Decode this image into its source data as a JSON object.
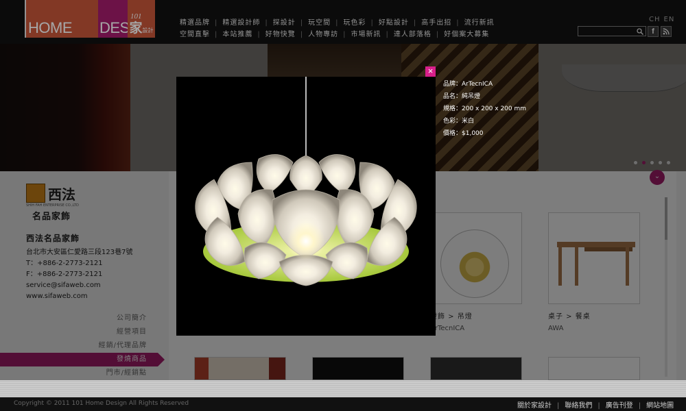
{
  "header": {
    "logo": {
      "home": "HOME",
      "design": "DESIGN",
      "jia": "家",
      "jia_small": "設計",
      "num": "101"
    },
    "nav_row1": [
      "精選品牌",
      "精選設計師",
      "探設計",
      "玩空間",
      "玩色彩",
      "好點設計",
      "高手出招",
      "流行新訊"
    ],
    "nav_row2": [
      "空間直擊",
      "本站推薦",
      "好物快覽",
      "人物專訪",
      "市場新訊",
      "達人部落格",
      "好個案大募集"
    ],
    "lang": [
      "CH",
      "EN"
    ],
    "search_placeholder": "",
    "facebook_label": "f"
  },
  "colors": {
    "brand_magenta": "#a61c6d",
    "brand_orange": "#c8563a",
    "close_pink": "#d81f8a"
  },
  "brand": {
    "logo_text": "西法",
    "logo_en": "SHIH FAH ENTERPRISE CO.,LTD",
    "subtitle": "名品家飾",
    "shop_name": "西法名品家飾",
    "address": "台北市大安區仁愛路三段123巷7號",
    "tel": "T：+886-2-2773-2121",
    "fax": "F：+886-2-2773-2121",
    "email": "service@sifaweb.com",
    "website": "www.sifaweb.com"
  },
  "side_menu": [
    {
      "label": "公司簡介",
      "active": false
    },
    {
      "label": "經營項目",
      "active": false
    },
    {
      "label": "經銷/代理品牌",
      "active": false
    },
    {
      "label": "發燒商品",
      "active": true
    },
    {
      "label": "門市/經銷點",
      "active": false
    }
  ],
  "products": {
    "item1_caption": "燈飾 > 吊燈",
    "item1_brand": "ArTecnICA",
    "item2_caption": "桌子 > 餐桌",
    "item2_brand": "AWA"
  },
  "banner": {
    "active_dot": 1,
    "dot_count": 5
  },
  "modal": {
    "close_label": "×",
    "specs": [
      "品牌：ArTecnICA",
      "品名：純吊燈",
      "規格：200 x 200 x 200 mm",
      "色彩：米白",
      "價格：$1,000"
    ]
  },
  "footer": {
    "copyright": "Copyright © 2011  101 Home Design All Rights Reserved",
    "links": [
      "關於家設計",
      "聯絡我們",
      "廣告刊登",
      "網站地圖"
    ]
  }
}
